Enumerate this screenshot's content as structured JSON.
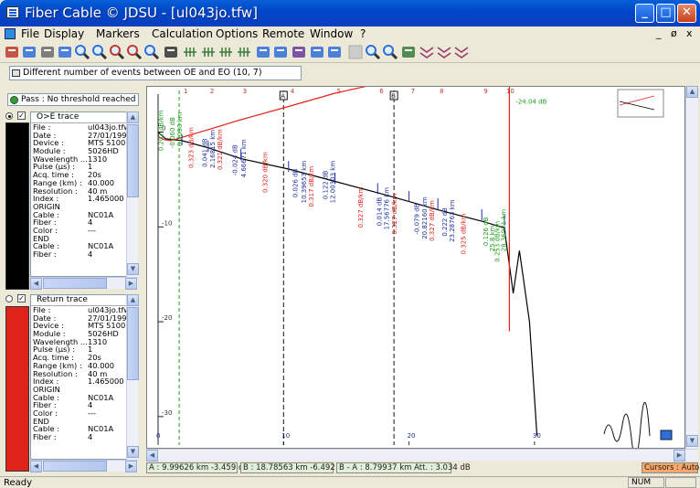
{
  "window": {
    "title": "Fiber Cable © JDSU - [ul043jo.tfw]",
    "controls": [
      "_",
      "□",
      "✕"
    ],
    "mdi_controls": [
      "_",
      "ø",
      "x"
    ]
  },
  "menu": {
    "items": [
      "File",
      "Display",
      "Markers",
      "Calculation",
      "Options",
      "Remote",
      "Window",
      "?"
    ]
  },
  "toolbar": {
    "icons": [
      "open-folder-icon",
      "open-arrow-icon",
      "print-icon",
      "print-preview-icon",
      "zoom-in-icon",
      "zoom-out-icon",
      "zoom-cross-icon",
      "zoom-x-icon",
      "zoom-icon",
      "table-icon",
      "markers-4pt-icon",
      "markers-3pt-icon",
      "markers-2pt-icon",
      "markers-icon",
      "splice-icon",
      "measure-icon",
      "event-table-icon",
      "edit-icon",
      "undo-icon",
      "disabled-icon",
      "zoom-minus-icon",
      "zoom-plus-icon",
      "grid-icon",
      "overlay-icon",
      "overlay-down-icon",
      "overlay-up-icon"
    ]
  },
  "message": {
    "text": "Different number of events between OE and EO (10, 7)"
  },
  "left_panel": {
    "pass_text": "Pass : No threshold reached",
    "traces": [
      {
        "header": "O>E trace",
        "color": "#000000",
        "selected": true,
        "checked": "✓",
        "rows": [
          {
            "k": "File :",
            "v": "ul043jo.tfw"
          },
          {
            "k": "Date :",
            "v": "27/01/199"
          },
          {
            "k": "Device :",
            "v": "MTS 5100"
          },
          {
            "k": "Module :",
            "v": "5026HD"
          },
          {
            "k": "Wavelength ...",
            "v": "1310"
          },
          {
            "k": "Pulse (µs) :",
            "v": "1"
          },
          {
            "k": "Acq. time :",
            "v": "20s"
          },
          {
            "k": "Range (km) :",
            "v": "40.000"
          },
          {
            "k": "Resolution :",
            "v": "40 m"
          },
          {
            "k": "Index :",
            "v": "1.465000"
          },
          {
            "k": "ORIGIN",
            "v": ""
          },
          {
            "k": "   Cable :",
            "v": "NC01A"
          },
          {
            "k": "   Fiber :",
            "v": "4"
          },
          {
            "k": "   Color :",
            "v": "---"
          },
          {
            "k": "END",
            "v": ""
          },
          {
            "k": "   Cable :",
            "v": "NC01A"
          },
          {
            "k": "   Fiber :",
            "v": "4"
          }
        ]
      },
      {
        "header": "Return trace",
        "color": "#e0231b",
        "selected": false,
        "checked": "✓",
        "rows": [
          {
            "k": "File :",
            "v": "ul043jo.tfw"
          },
          {
            "k": "Date :",
            "v": "27/01/199"
          },
          {
            "k": "Device :",
            "v": "MTS 5100"
          },
          {
            "k": "Module :",
            "v": "5026HD"
          },
          {
            "k": "Wavelength ...",
            "v": "1310"
          },
          {
            "k": "Pulse (µs) :",
            "v": "1"
          },
          {
            "k": "Acq. time :",
            "v": "20s"
          },
          {
            "k": "Range (km) :",
            "v": "40.000"
          },
          {
            "k": "Resolution :",
            "v": "40 m"
          },
          {
            "k": "Index :",
            "v": "1.465000"
          },
          {
            "k": "ORIGIN",
            "v": ""
          },
          {
            "k": "   Cable :",
            "v": "NC01A"
          },
          {
            "k": "   Fiber :",
            "v": "4"
          },
          {
            "k": "   Color :",
            "v": "---"
          },
          {
            "k": "END",
            "v": ""
          },
          {
            "k": "   Cable :",
            "v": "NC01A"
          },
          {
            "k": "   Fiber :",
            "v": "4"
          }
        ]
      }
    ]
  },
  "chart_data": {
    "type": "line",
    "x_ticks": [
      "0",
      "10",
      "20",
      "30"
    ],
    "y_ticks": [
      "0",
      "-10",
      "-20",
      "-30"
    ],
    "xlim": [
      0,
      37
    ],
    "ylim": [
      -33,
      4
    ],
    "event_numbers": [
      "1",
      "2",
      "3",
      "4",
      "5",
      "6",
      "7",
      "8",
      "9",
      "10"
    ],
    "event_km": [
      1.9,
      4.0,
      6.6,
      10.4,
      14.1,
      17.5,
      20.0,
      22.3,
      25.8,
      27.6
    ],
    "markers": [
      {
        "label": "A",
        "km": 10.0
      },
      {
        "label": "B",
        "km": 18.8
      }
    ],
    "series": [
      {
        "name": "O>E trace",
        "color": "#000000",
        "x": [
          0,
          0.6,
          1.9,
          4.1,
          6.6,
          10.4,
          14.1,
          17.5,
          19.4,
          22.3,
          25.8,
          27.6,
          28.3,
          28.8,
          29.6,
          30.2
        ],
        "y": [
          0,
          -0.7,
          -0.9,
          -1.7,
          -2.8,
          -3.9,
          -5.2,
          -6.4,
          -7.1,
          -8.2,
          -9.4,
          -10.1,
          -17.0,
          -12.5,
          -20.0,
          -32.0
        ]
      },
      {
        "name": "Return trace",
        "color": "#e0231b",
        "x": [
          0,
          0.5,
          1.0,
          4.1,
          6.6,
          10.4,
          14.1,
          17.5,
          20.8,
          23.5,
          26.0,
          27.6,
          28.0,
          28.0
        ],
        "y": [
          -0.5,
          -0.8,
          -0.9,
          0.3,
          1.3,
          2.7,
          4.1,
          5.1,
          6.4,
          7.3,
          8.2,
          8.8,
          7.0,
          -21.0
        ]
      }
    ],
    "annotations": [
      {
        "text": "0.202 dB/km",
        "x": 0.4,
        "y": -2.0,
        "color": "#1f9f1f"
      },
      {
        "text": "-0.060 dB",
        "x": 1.3,
        "y": -1.7,
        "color": "#1f9f1f"
      },
      {
        "text": "0.2090 km",
        "x": 1.9,
        "y": -1.5,
        "color": "#1f9f1f"
      },
      {
        "text": "0.323 dB/km",
        "x": 2.8,
        "y": -3.8,
        "color": "#e0231b"
      },
      {
        "text": "0.041 dB",
        "x": 3.9,
        "y": -3.7,
        "color": "#1f2f9f"
      },
      {
        "text": "2.16815 km",
        "x": 4.5,
        "y": -3.8,
        "color": "#1f2f9f"
      },
      {
        "text": "0.321 dB/km",
        "x": 5.1,
        "y": -4.0,
        "color": "#e0231b"
      },
      {
        "text": "-0.024 dB",
        "x": 6.3,
        "y": -4.6,
        "color": "#1f2f9f"
      },
      {
        "text": "4.66671 km",
        "x": 7.0,
        "y": -4.8,
        "color": "#1f2f9f"
      },
      {
        "text": "0.320 dB/km",
        "x": 8.7,
        "y": -6.4,
        "color": "#e0231b"
      },
      {
        "text": "0.026 dB",
        "x": 11.1,
        "y": -6.9,
        "color": "#1f2f9f"
      },
      {
        "text": "10.39653 km",
        "x": 11.8,
        "y": -7.5,
        "color": "#1f2f9f"
      },
      {
        "text": "0.317 dB/km",
        "x": 12.4,
        "y": -7.9,
        "color": "#e0231b"
      },
      {
        "text": "0.122 dB",
        "x": 13.5,
        "y": -7.1,
        "color": "#1f2f9f"
      },
      {
        "text": "12.00303 km",
        "x": 14.1,
        "y": -7.5,
        "color": "#1f2f9f"
      },
      {
        "text": "0.327 dB/km",
        "x": 16.3,
        "y": -10.1,
        "color": "#e0231b"
      },
      {
        "text": "0.014 dB",
        "x": 17.8,
        "y": -9.9,
        "color": "#1f2f9f"
      },
      {
        "text": "17.56776 km",
        "x": 18.4,
        "y": -10.3,
        "color": "#1f2f9f"
      },
      {
        "text": "0.327 dB/km",
        "x": 19.0,
        "y": -10.8,
        "color": "#e0231b"
      },
      {
        "text": "-0.079 dB",
        "x": 20.8,
        "y": -10.8,
        "color": "#1f2f9f"
      },
      {
        "text": "20.82160 km",
        "x": 21.4,
        "y": -11.3,
        "color": "#1f2f9f"
      },
      {
        "text": "0.327 dB/km",
        "x": 22.0,
        "y": -11.5,
        "color": "#e0231b"
      },
      {
        "text": "0.222 dB",
        "x": 23.0,
        "y": -11.0,
        "color": "#1f2f9f"
      },
      {
        "text": "23.28763 km",
        "x": 23.6,
        "y": -11.6,
        "color": "#1f2f9f"
      },
      {
        "text": "0.325 dB/km",
        "x": 24.5,
        "y": -12.9,
        "color": "#e0231b"
      },
      {
        "text": "0.126 dB",
        "x": 26.3,
        "y": -12.0,
        "color": "#1f9f1f"
      },
      {
        "text": "25.8 km",
        "x": 26.8,
        "y": -12.6,
        "color": "#1f9f1f"
      },
      {
        "text": "0.253 dB/km",
        "x": 27.2,
        "y": -13.7,
        "color": "#1f9f1f"
      },
      {
        "text": "28.36971 km",
        "x": 27.7,
        "y": -12.6,
        "color": "#1f9f1f"
      },
      {
        "text": "-24.04 dB",
        "x": 28.5,
        "y": 3.0,
        "color": "#1f9f1f"
      }
    ]
  },
  "status": {
    "marker_a": "A : 9.99626 km -3.459 dB",
    "marker_b": "B : 18.78563 km -6.492 dB",
    "marker_ba": "B - A : 8.79937 km Att. : 3.034 dB",
    "cursors": "Cursors : Auto",
    "ready": "Ready",
    "num": "NUM"
  }
}
